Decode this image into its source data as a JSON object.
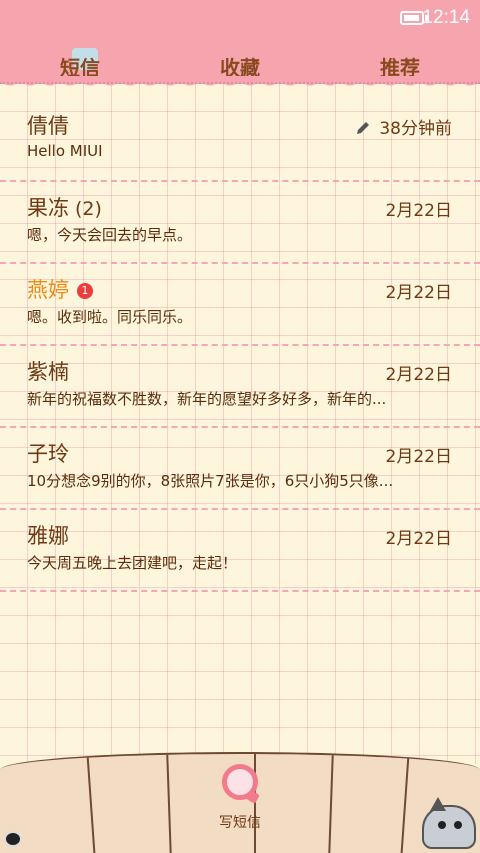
{
  "status_bar": {
    "time": "12:14"
  },
  "tabs": [
    {
      "label": "短信"
    },
    {
      "label": "收藏"
    },
    {
      "label": "推荐"
    }
  ],
  "threads": [
    {
      "name": "倩倩",
      "count": "",
      "unread": false,
      "badge": "",
      "date": "38分钟前",
      "draft": true,
      "preview": "Hello MIUI"
    },
    {
      "name": "果冻",
      "count": "(2)",
      "unread": false,
      "badge": "",
      "date": "2月22日",
      "draft": false,
      "preview": "嗯，今天会回去的早点。"
    },
    {
      "name": "燕婷",
      "count": "",
      "unread": true,
      "badge": "1",
      "date": "2月22日",
      "draft": false,
      "preview": "嗯。收到啦。同乐同乐。"
    },
    {
      "name": "紫楠",
      "count": "",
      "unread": false,
      "badge": "",
      "date": "2月22日",
      "draft": false,
      "preview": "新年的祝福数不胜数，新年的愿望好多好多，新年的..."
    },
    {
      "name": "子玲",
      "count": "",
      "unread": false,
      "badge": "",
      "date": "2月22日",
      "draft": false,
      "preview": "10分想念9别的你，8张照片7张是你，6只小狗5只像..."
    },
    {
      "name": "雅娜",
      "count": "",
      "unread": false,
      "badge": "",
      "date": "2月22日",
      "draft": false,
      "preview": "今天周五晚上去团建吧，走起！"
    }
  ],
  "compose": {
    "label": "写短信"
  },
  "colors": {
    "header": "#f6a5ae",
    "paper": "#fdf6dc",
    "unread_name": "#f08a16",
    "badge": "#ee3b3b",
    "compose_icon": "#f37a8a"
  }
}
